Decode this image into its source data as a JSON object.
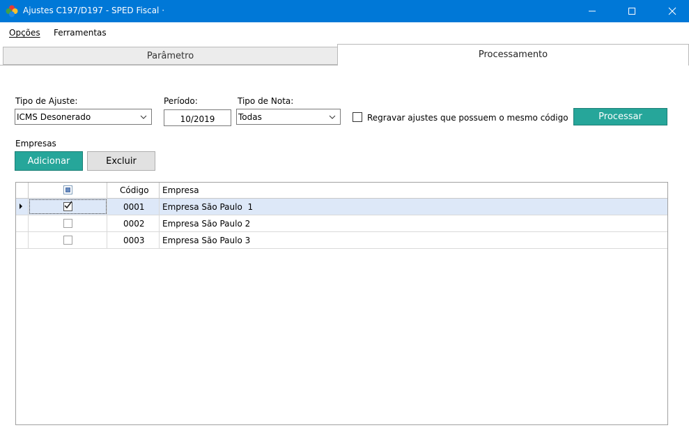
{
  "window": {
    "title": "Ajustes C197/D197 - SPED Fiscal ·",
    "minimize_label": "—",
    "icons": {
      "app": "app-logo-icon",
      "minimize": "minimize-icon",
      "maximize": "maximize-icon",
      "close": "close-icon"
    }
  },
  "menu": {
    "opcoes": "Opções",
    "ferramentas": "Ferramentas"
  },
  "tabs": {
    "parametro": "Parâmetro",
    "processamento": "Processamento",
    "active": "processamento"
  },
  "form": {
    "tipo_ajuste_label": "Tipo de Ajuste:",
    "tipo_ajuste_value": "ICMS Desonerado",
    "periodo_label": "Período:",
    "periodo_value": "10/2019",
    "tipo_nota_label": "Tipo de Nota:",
    "tipo_nota_value": "Todas",
    "regravar_label": "Regravar ajustes que possuem o mesmo código",
    "regravar_checked": false,
    "processar_label": "Processar"
  },
  "empresas": {
    "label": "Empresas",
    "adicionar_label": "Adicionar",
    "excluir_label": "Excluir",
    "grid": {
      "headers": {
        "codigo": "Código",
        "empresa": "Empresa"
      },
      "rows": [
        {
          "codigo": "0001",
          "empresa": "Empresa São Paulo  1",
          "checked": true,
          "selected": true
        },
        {
          "codigo": "0002",
          "empresa": "Empresa São Paulo 2",
          "checked": false,
          "selected": false
        },
        {
          "codigo": "0003",
          "empresa": "Empresa São Paulo 3",
          "checked": false,
          "selected": false
        }
      ]
    }
  },
  "colors": {
    "titlebar": "#0078d7",
    "accent_teal": "#26a69a",
    "selected_row": "#dde8f8"
  }
}
